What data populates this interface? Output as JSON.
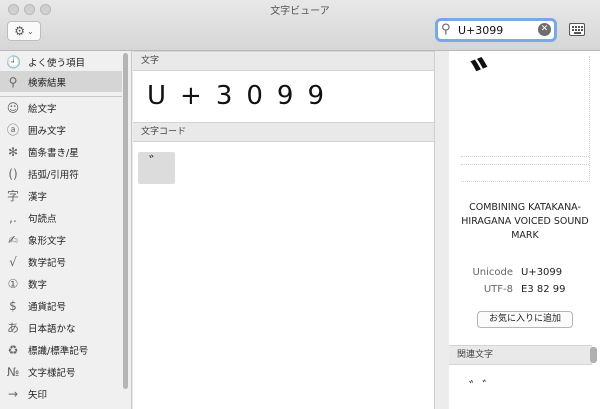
{
  "window": {
    "title": "文字ビューア"
  },
  "toolbar": {
    "gear_icon": "gear-icon",
    "chevron": "⌄"
  },
  "search": {
    "value": "U+3099",
    "icon": "search-icon"
  },
  "sidebar": {
    "items": [
      {
        "icon": "clock-icon",
        "glyph": "🕘",
        "label": "よく使う項目"
      },
      {
        "icon": "search-icon",
        "glyph": "⚲",
        "label": "検索結果",
        "selected": true
      },
      {
        "icon": "smiley-icon",
        "glyph": "☺",
        "label": "絵文字"
      },
      {
        "icon": "circled-a-icon",
        "glyph": "ⓐ",
        "label": "囲み文字"
      },
      {
        "icon": "asterisk-icon",
        "glyph": "✻",
        "label": "箇条書き/星"
      },
      {
        "icon": "parentheses-icon",
        "glyph": "()",
        "label": "括弧/引用符"
      },
      {
        "icon": "kanji-icon",
        "glyph": "字",
        "label": "漢字"
      },
      {
        "icon": "punctuation-icon",
        "glyph": ",.",
        "label": "句読点"
      },
      {
        "icon": "pictograph-icon",
        "glyph": "✍",
        "label": "象形文字"
      },
      {
        "icon": "sqrt-icon",
        "glyph": "√",
        "label": "数学記号"
      },
      {
        "icon": "circled-one-icon",
        "glyph": "①",
        "label": "数字"
      },
      {
        "icon": "dollar-icon",
        "glyph": "$",
        "label": "通貨記号"
      },
      {
        "icon": "hiragana-icon",
        "glyph": "あ",
        "label": "日本語かな"
      },
      {
        "icon": "recycle-icon",
        "glyph": "♻",
        "label": "標識/標準記号"
      },
      {
        "icon": "numero-icon",
        "glyph": "№",
        "label": "文字様記号"
      },
      {
        "icon": "arrow-icon",
        "glyph": "→",
        "label": "矢印"
      }
    ]
  },
  "main": {
    "char_header": "文字",
    "char_display": "U+3099",
    "code_header": "文字コード",
    "code_tile": "゛"
  },
  "detail": {
    "glyph": "゛",
    "name": "COMBINING KATAKANA-HIRAGANA VOICED SOUND MARK",
    "unicode_label": "Unicode",
    "unicode_value": "U+3099",
    "utf8_label": "UTF-8",
    "utf8_value": "E3 82 99",
    "favorite_button": "お気に入りに追加",
    "related_header": "関連文字",
    "related_chars": "゛ ゙"
  }
}
